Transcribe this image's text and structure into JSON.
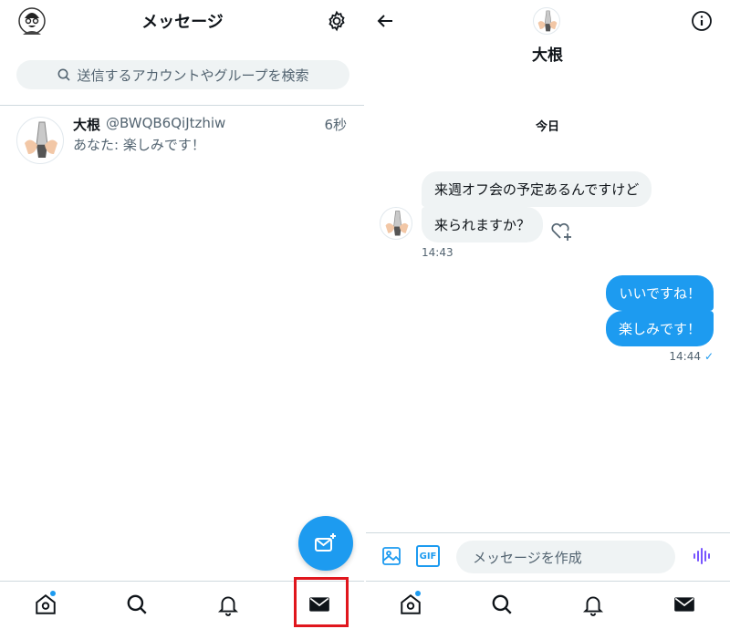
{
  "left": {
    "header": {
      "title": "メッセージ"
    },
    "search": {
      "placeholder": "送信するアカウントやグループを検索"
    },
    "conversation": {
      "name": "大根",
      "handle": "@BWQB6QiJtzhiw",
      "time": "6秒",
      "preview": "あなた: 楽しみです！"
    }
  },
  "right": {
    "header": {
      "name": "大根"
    },
    "date_separator": "今日",
    "messages": [
      {
        "from": "them",
        "text": "来週オフ会の予定あるんですけど"
      },
      {
        "from": "them",
        "text": "来られますか？"
      },
      {
        "from": "me",
        "text": "いいですね！"
      },
      {
        "from": "me",
        "text": "楽しみです！"
      }
    ],
    "them_time": "14:43",
    "me_time": "14:44",
    "read_mark": "✓",
    "composer": {
      "placeholder": "メッセージを作成",
      "gif_label": "GIF"
    }
  },
  "icons": [
    "profile-avatar",
    "gear-icon",
    "search-icon",
    "compose-message-icon",
    "home-icon",
    "explore-icon",
    "bell-icon",
    "mail-icon",
    "back-arrow-icon",
    "info-icon",
    "heart-add-icon",
    "image-icon",
    "gif-icon",
    "voice-icon"
  ],
  "colors": {
    "accent": "#1d9bf0",
    "highlight": "#e0161d",
    "bubble_in": "#eff3f4"
  }
}
